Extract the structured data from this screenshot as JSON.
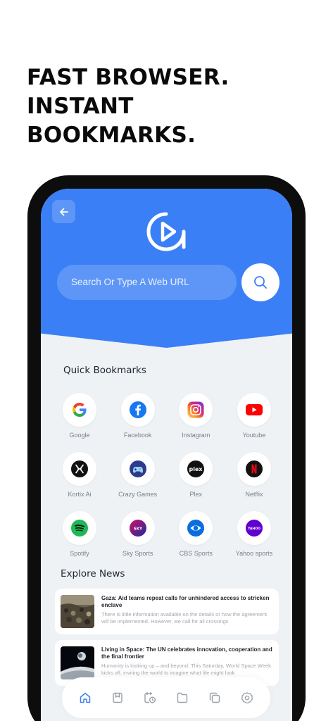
{
  "headline": {
    "line1": "FAST BROWSER.",
    "line2": "INSTANT",
    "line3": "BOOKMARKS."
  },
  "colors": {
    "accent": "#3b7ff6",
    "background": "#eef2f5",
    "frame": "#0d0d0d"
  },
  "header": {
    "back_icon": "arrow-left-icon",
    "logo_icon": "browser-logo-icon"
  },
  "search": {
    "placeholder": "Search Or Type A Web URL",
    "button_icon": "search-icon"
  },
  "bookmarks": {
    "title": "Quick Bookmarks",
    "items": [
      {
        "label": "Google",
        "icon": "google-icon"
      },
      {
        "label": "Facebook",
        "icon": "facebook-icon"
      },
      {
        "label": "Instagram",
        "icon": "instagram-icon"
      },
      {
        "label": "Youtube",
        "icon": "youtube-icon"
      },
      {
        "label": "Kortix Ai",
        "icon": "kortix-icon"
      },
      {
        "label": "Crazy Games",
        "icon": "crazy-games-icon"
      },
      {
        "label": "Plex",
        "icon": "plex-icon"
      },
      {
        "label": "Netflix",
        "icon": "netflix-icon"
      },
      {
        "label": "Spotify",
        "icon": "spotify-icon"
      },
      {
        "label": "Sky Sports",
        "icon": "sky-sports-icon"
      },
      {
        "label": "CBS Sports",
        "icon": "cbs-sports-icon"
      },
      {
        "label": "Yahoo sports",
        "icon": "yahoo-sports-icon"
      }
    ],
    "logo_text": {
      "plex": "plex",
      "sky": "SKY",
      "yahoo": "YAHOO"
    }
  },
  "news": {
    "title": "Explore News",
    "items": [
      {
        "title": "Gaza: Aid teams repeat calls for unhindered access to stricken enclave",
        "description": "There is little information available on the details or how the agreement will be implemented. However, we call for all crossings"
      },
      {
        "title": "Living in Space: The UN celebrates innovation, cooperation and the final frontier",
        "description": "Humanity is looking up – and beyond. This Saturday, World Space Week kicks off, inviting the world to imagine what life might look"
      }
    ]
  },
  "bottom_nav": {
    "items": [
      {
        "icon": "home-icon",
        "active": true
      },
      {
        "icon": "bookmark-icon",
        "active": false
      },
      {
        "icon": "history-icon",
        "active": false
      },
      {
        "icon": "folder-icon",
        "active": false
      },
      {
        "icon": "tabs-icon",
        "active": false
      },
      {
        "icon": "settings-icon",
        "active": false
      }
    ]
  }
}
